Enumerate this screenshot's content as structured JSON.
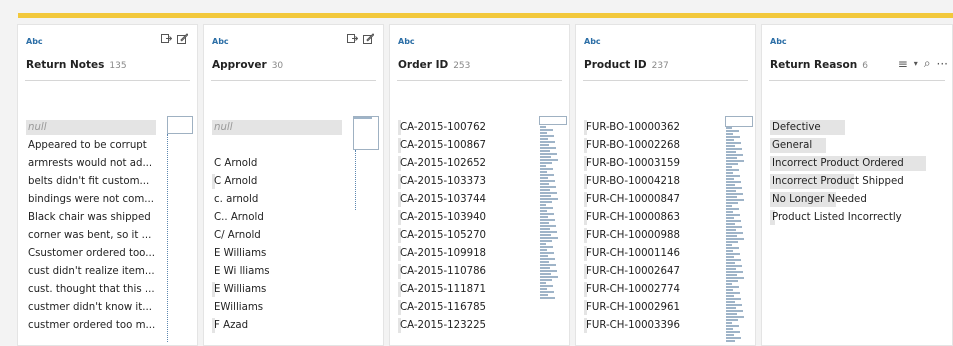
{
  "columns": [
    {
      "type": "Abc",
      "title": "Return Notes",
      "count": "135",
      "values": [
        "null",
        "Appeared to be corrupt",
        "armrests would not ad...",
        "belts didn't fit custom...",
        "bindings were not com...",
        "Black chair was shipped",
        "corner was bent, so it ...",
        "Csustomer ordered too...",
        "cust didn't realize item...",
        "cust. thought that this ...",
        "custmer didn't know it...",
        "custmer ordered too m..."
      ],
      "icons": [
        "export-icon",
        "edit-icon"
      ]
    },
    {
      "type": "Abc",
      "title": "Approver",
      "count": "30",
      "values": [
        "null",
        "",
        "C  Arnold",
        "C Arnold",
        "c. arnold",
        "C.. Arnold",
        "C/ Arnold",
        "E  Williams",
        "E Wi lliams",
        "E Williams",
        "EWilliams",
        "F Azad"
      ],
      "icons": [
        "export-icon",
        "edit-icon"
      ]
    },
    {
      "type": "Abc",
      "title": "Order ID",
      "count": "253",
      "values": [
        "CA-2015-100762",
        "CA-2015-100867",
        "CA-2015-102652",
        "CA-2015-103373",
        "CA-2015-103744",
        "CA-2015-103940",
        "CA-2015-105270",
        "CA-2015-109918",
        "CA-2015-110786",
        "CA-2015-111871",
        "CA-2015-116785",
        "CA-2015-123225"
      ],
      "icons": []
    },
    {
      "type": "Abc",
      "title": "Product ID",
      "count": "237",
      "values": [
        "FUR-BO-10000362",
        "FUR-BO-10002268",
        "FUR-BO-10003159",
        "FUR-BO-10004218",
        "FUR-CH-10000847",
        "FUR-CH-10000863",
        "FUR-CH-10000988",
        "FUR-CH-10001146",
        "FUR-CH-10002647",
        "FUR-CH-10002774",
        "FUR-CH-10002961",
        "FUR-CH-10003396"
      ],
      "icons": []
    },
    {
      "type": "Abc",
      "title": "Return Reason",
      "count": "6",
      "values": [
        "Defective",
        "General",
        "Incorrect Product Ordered",
        "Incorrect Product Shipped",
        "No Longer Needed",
        "Product Listed Incorrectly"
      ],
      "value_shares": [
        0.48,
        0.36,
        1.0,
        0.54,
        0.42,
        0.03
      ],
      "icons": [
        "sort-icon",
        "dropdown-caret-icon",
        "search-icon",
        "more-icon"
      ],
      "icon_glyphs": {
        "sort-icon": "≡",
        "dropdown-caret-icon": "▾",
        "search-icon": "⌕",
        "more-icon": "···"
      }
    }
  ],
  "colors": {
    "accent_bar": "#f2c83b",
    "type_tag": "#2b6ea6",
    "value_highlight": "#e4e4e4"
  }
}
